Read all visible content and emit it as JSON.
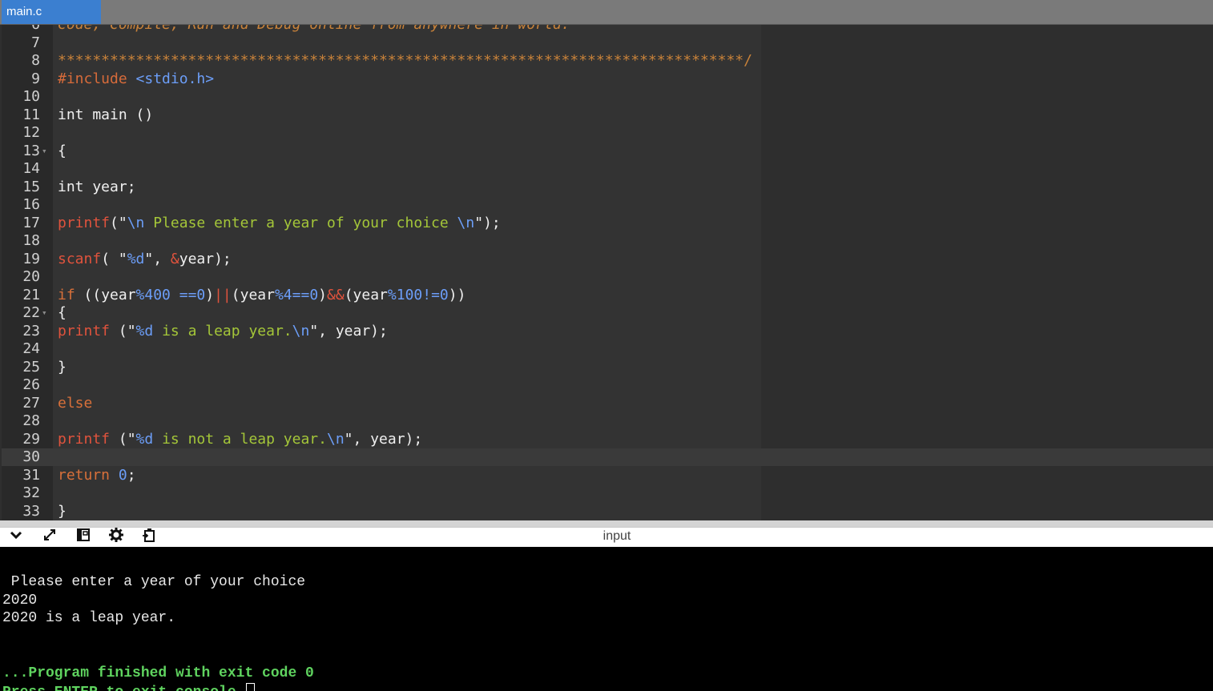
{
  "tabs": [
    {
      "label": "main.c"
    }
  ],
  "editor": {
    "lines": [
      {
        "n": "6",
        "fold": false,
        "tokens": [
          {
            "t": "Code, Compile, Run and Debug online from anywhere in world.",
            "c": "c-comment"
          }
        ]
      },
      {
        "n": "7",
        "fold": false,
        "tokens": []
      },
      {
        "n": "8",
        "fold": false,
        "tokens": [
          {
            "t": "*******************************************************************************/",
            "c": "c-star"
          }
        ]
      },
      {
        "n": "9",
        "fold": false,
        "tokens": [
          {
            "t": "#include ",
            "c": "c-prep"
          },
          {
            "t": "<stdio.h>",
            "c": "c-inc"
          }
        ]
      },
      {
        "n": "10",
        "fold": false,
        "tokens": []
      },
      {
        "n": "11",
        "fold": false,
        "tokens": [
          {
            "t": "int main ()",
            "c": "c-plain"
          }
        ]
      },
      {
        "n": "12",
        "fold": false,
        "tokens": []
      },
      {
        "n": "13",
        "fold": true,
        "tokens": [
          {
            "t": "{",
            "c": "c-plain"
          }
        ]
      },
      {
        "n": "14",
        "fold": false,
        "tokens": []
      },
      {
        "n": "15",
        "fold": false,
        "tokens": [
          {
            "t": "int year;",
            "c": "c-plain"
          }
        ]
      },
      {
        "n": "16",
        "fold": false,
        "tokens": []
      },
      {
        "n": "17",
        "fold": false,
        "tokens": [
          {
            "t": "printf",
            "c": "c-fn"
          },
          {
            "t": "(\"",
            "c": "c-plain"
          },
          {
            "t": "\\n",
            "c": "c-esc"
          },
          {
            "t": " Please enter a year of your choice ",
            "c": "c-str"
          },
          {
            "t": "\\n",
            "c": "c-esc"
          },
          {
            "t": "\");",
            "c": "c-plain"
          }
        ]
      },
      {
        "n": "18",
        "fold": false,
        "tokens": []
      },
      {
        "n": "19",
        "fold": false,
        "tokens": [
          {
            "t": "scanf",
            "c": "c-fn"
          },
          {
            "t": "( \"",
            "c": "c-plain"
          },
          {
            "t": "%d",
            "c": "c-esc"
          },
          {
            "t": "\", ",
            "c": "c-plain"
          },
          {
            "t": "&",
            "c": "c-op"
          },
          {
            "t": "year);",
            "c": "c-plain"
          }
        ]
      },
      {
        "n": "20",
        "fold": false,
        "tokens": []
      },
      {
        "n": "21",
        "fold": false,
        "tokens": [
          {
            "t": "if",
            "c": "c-kw"
          },
          {
            "t": " ((year",
            "c": "c-plain"
          },
          {
            "t": "%400 ==",
            "c": "c-num"
          },
          {
            "t": "0",
            "c": "c-num"
          },
          {
            "t": ")",
            "c": "c-plain"
          },
          {
            "t": "||",
            "c": "c-op"
          },
          {
            "t": "(year",
            "c": "c-plain"
          },
          {
            "t": "%4==",
            "c": "c-num"
          },
          {
            "t": "0",
            "c": "c-num"
          },
          {
            "t": ")",
            "c": "c-plain"
          },
          {
            "t": "&&",
            "c": "c-op"
          },
          {
            "t": "(year",
            "c": "c-plain"
          },
          {
            "t": "%100!=",
            "c": "c-num"
          },
          {
            "t": "0",
            "c": "c-num"
          },
          {
            "t": "))",
            "c": "c-plain"
          }
        ]
      },
      {
        "n": "22",
        "fold": true,
        "tokens": [
          {
            "t": "{",
            "c": "c-plain"
          }
        ]
      },
      {
        "n": "23",
        "fold": false,
        "tokens": [
          {
            "t": "printf",
            "c": "c-fn"
          },
          {
            "t": " (\"",
            "c": "c-plain"
          },
          {
            "t": "%d",
            "c": "c-esc"
          },
          {
            "t": " is a leap year.",
            "c": "c-str"
          },
          {
            "t": "\\n",
            "c": "c-esc"
          },
          {
            "t": "\", year);",
            "c": "c-plain"
          }
        ]
      },
      {
        "n": "24",
        "fold": false,
        "tokens": []
      },
      {
        "n": "25",
        "fold": false,
        "tokens": [
          {
            "t": "}",
            "c": "c-plain"
          }
        ]
      },
      {
        "n": "26",
        "fold": false,
        "tokens": []
      },
      {
        "n": "27",
        "fold": false,
        "tokens": [
          {
            "t": "else",
            "c": "c-kw"
          }
        ]
      },
      {
        "n": "28",
        "fold": false,
        "tokens": []
      },
      {
        "n": "29",
        "fold": false,
        "tokens": [
          {
            "t": "printf",
            "c": "c-fn"
          },
          {
            "t": " (\"",
            "c": "c-plain"
          },
          {
            "t": "%d",
            "c": "c-esc"
          },
          {
            "t": " is not a leap year.",
            "c": "c-str"
          },
          {
            "t": "\\n",
            "c": "c-esc"
          },
          {
            "t": "\", year);",
            "c": "c-plain"
          }
        ]
      },
      {
        "n": "30",
        "fold": false,
        "tokens": [],
        "active": true
      },
      {
        "n": "31",
        "fold": false,
        "tokens": [
          {
            "t": "return",
            "c": "c-kw"
          },
          {
            "t": " ",
            "c": "c-plain"
          },
          {
            "t": "0",
            "c": "c-num"
          },
          {
            "t": ";",
            "c": "c-plain"
          }
        ]
      },
      {
        "n": "32",
        "fold": false,
        "tokens": []
      },
      {
        "n": "33",
        "fold": false,
        "tokens": [
          {
            "t": "}",
            "c": "c-plain"
          }
        ]
      }
    ]
  },
  "toolbar": {
    "title": "input",
    "icons": [
      "chevron-down-icon",
      "expand-icon",
      "layout-icon",
      "gear-icon",
      "clipboard-icon"
    ]
  },
  "console": {
    "lines": [
      {
        "text": "",
        "style": "normal"
      },
      {
        "text": " Please enter a year of your choice",
        "style": "normal"
      },
      {
        "text": "2020",
        "style": "normal"
      },
      {
        "text": "2020 is a leap year.",
        "style": "normal"
      },
      {
        "text": "",
        "style": "normal"
      },
      {
        "text": "",
        "style": "normal"
      },
      {
        "text": "...Program finished with exit code 0",
        "style": "green"
      },
      {
        "text": "Press ENTER to exit console.",
        "style": "green",
        "cursor": true
      }
    ]
  },
  "colors": {
    "tab_active": "#3b7fd0",
    "console_success": "#5fd35f"
  }
}
